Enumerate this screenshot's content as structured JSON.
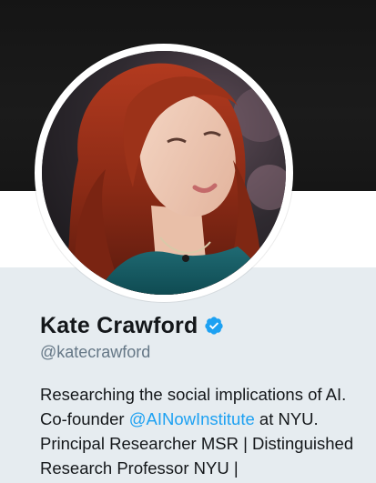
{
  "profile": {
    "name": "Kate Crawford",
    "handle": "@katecrawford",
    "verified_badge": "verified-checkmark-icon",
    "avatar_alt": "profile photo",
    "bio": {
      "line1": "Researching the social implications of AI.",
      "line2_prefix": "Co-founder ",
      "line2_mention": "@AINowInstitute",
      "line2_suffix": " at NYU.",
      "line3": "Principal Researcher MSR | Distinguished",
      "line4": "Research Professor NYU |"
    }
  },
  "colors": {
    "banner": "#161616",
    "background": "#e6ecf0",
    "link_blue": "#1da1f2",
    "verified_blue": "#1da1f2",
    "name_text": "#14171a",
    "handle_text": "#657786"
  }
}
